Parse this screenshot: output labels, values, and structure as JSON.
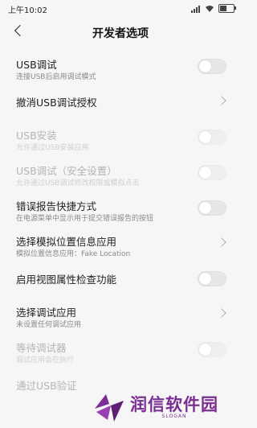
{
  "status_bar": {
    "time": "上午10:02",
    "battery_level": 0.6
  },
  "header": {
    "title": "开发者选项"
  },
  "rows": [
    {
      "title": "USB调试",
      "subtitle": "连接USB后启用调试模式",
      "control": "toggle",
      "on": false,
      "disabled": false
    },
    {
      "title": "撤消USB调试授权",
      "subtitle": "",
      "control": "chevron",
      "disabled": false
    },
    {
      "title": "USB安装",
      "subtitle": "允许通过USB安装应用",
      "control": "toggle",
      "on": false,
      "disabled": true
    },
    {
      "title": "USB调试（安全设置）",
      "subtitle": "允许通过USB调试修改权限或模拟点击",
      "control": "toggle",
      "on": false,
      "disabled": true
    },
    {
      "title": "错误报告快捷方式",
      "subtitle": "在电源菜单中显示用于提交错误报告的按钮",
      "control": "toggle",
      "on": false,
      "disabled": false
    },
    {
      "title": "选择模拟位置信息应用",
      "subtitle": "模拟位置信息应用：Fake Location",
      "control": "chevron",
      "disabled": false
    },
    {
      "title": "启用视图属性检查功能",
      "subtitle": "",
      "control": "toggle",
      "on": false,
      "disabled": false
    },
    {
      "title": "选择调试应用",
      "subtitle": "未设置任何调试应用",
      "control": "chevron",
      "disabled": false
    },
    {
      "title": "等待调试器",
      "subtitle": "调试应用会在执行",
      "control": "toggle",
      "on": false,
      "disabled": true
    },
    {
      "title": "通过USB验证",
      "subtitle": "",
      "control": "none",
      "disabled": true
    }
  ],
  "watermark": {
    "name": "润信软件园",
    "slogan": "SLOGAN",
    "color": "#7a2d92"
  }
}
